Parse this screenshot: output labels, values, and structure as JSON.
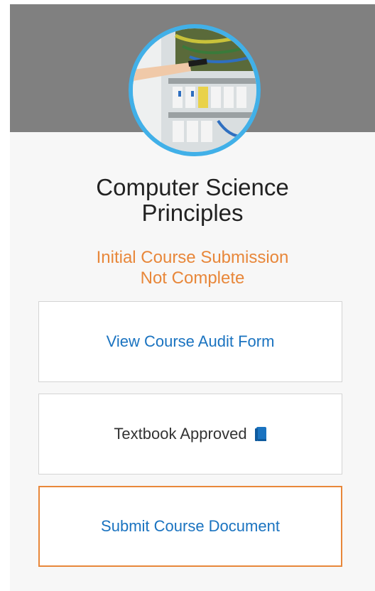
{
  "course": {
    "title_line1": "Computer Science",
    "title_line2": "Principles",
    "status_line1": "Initial Course Submission",
    "status_line2": "Not Complete"
  },
  "actions": {
    "audit_label": "View Course Audit Form",
    "textbook_label": "Textbook Approved",
    "textbook_icon": "book-icon",
    "submit_label": "Submit Course Document"
  },
  "colors": {
    "header_band": "#808080",
    "avatar_ring": "#41b0e8",
    "status_text": "#e8873a",
    "link_text": "#1a73c0",
    "submit_border": "#e8873a",
    "book_icon": "#1a73c0"
  }
}
